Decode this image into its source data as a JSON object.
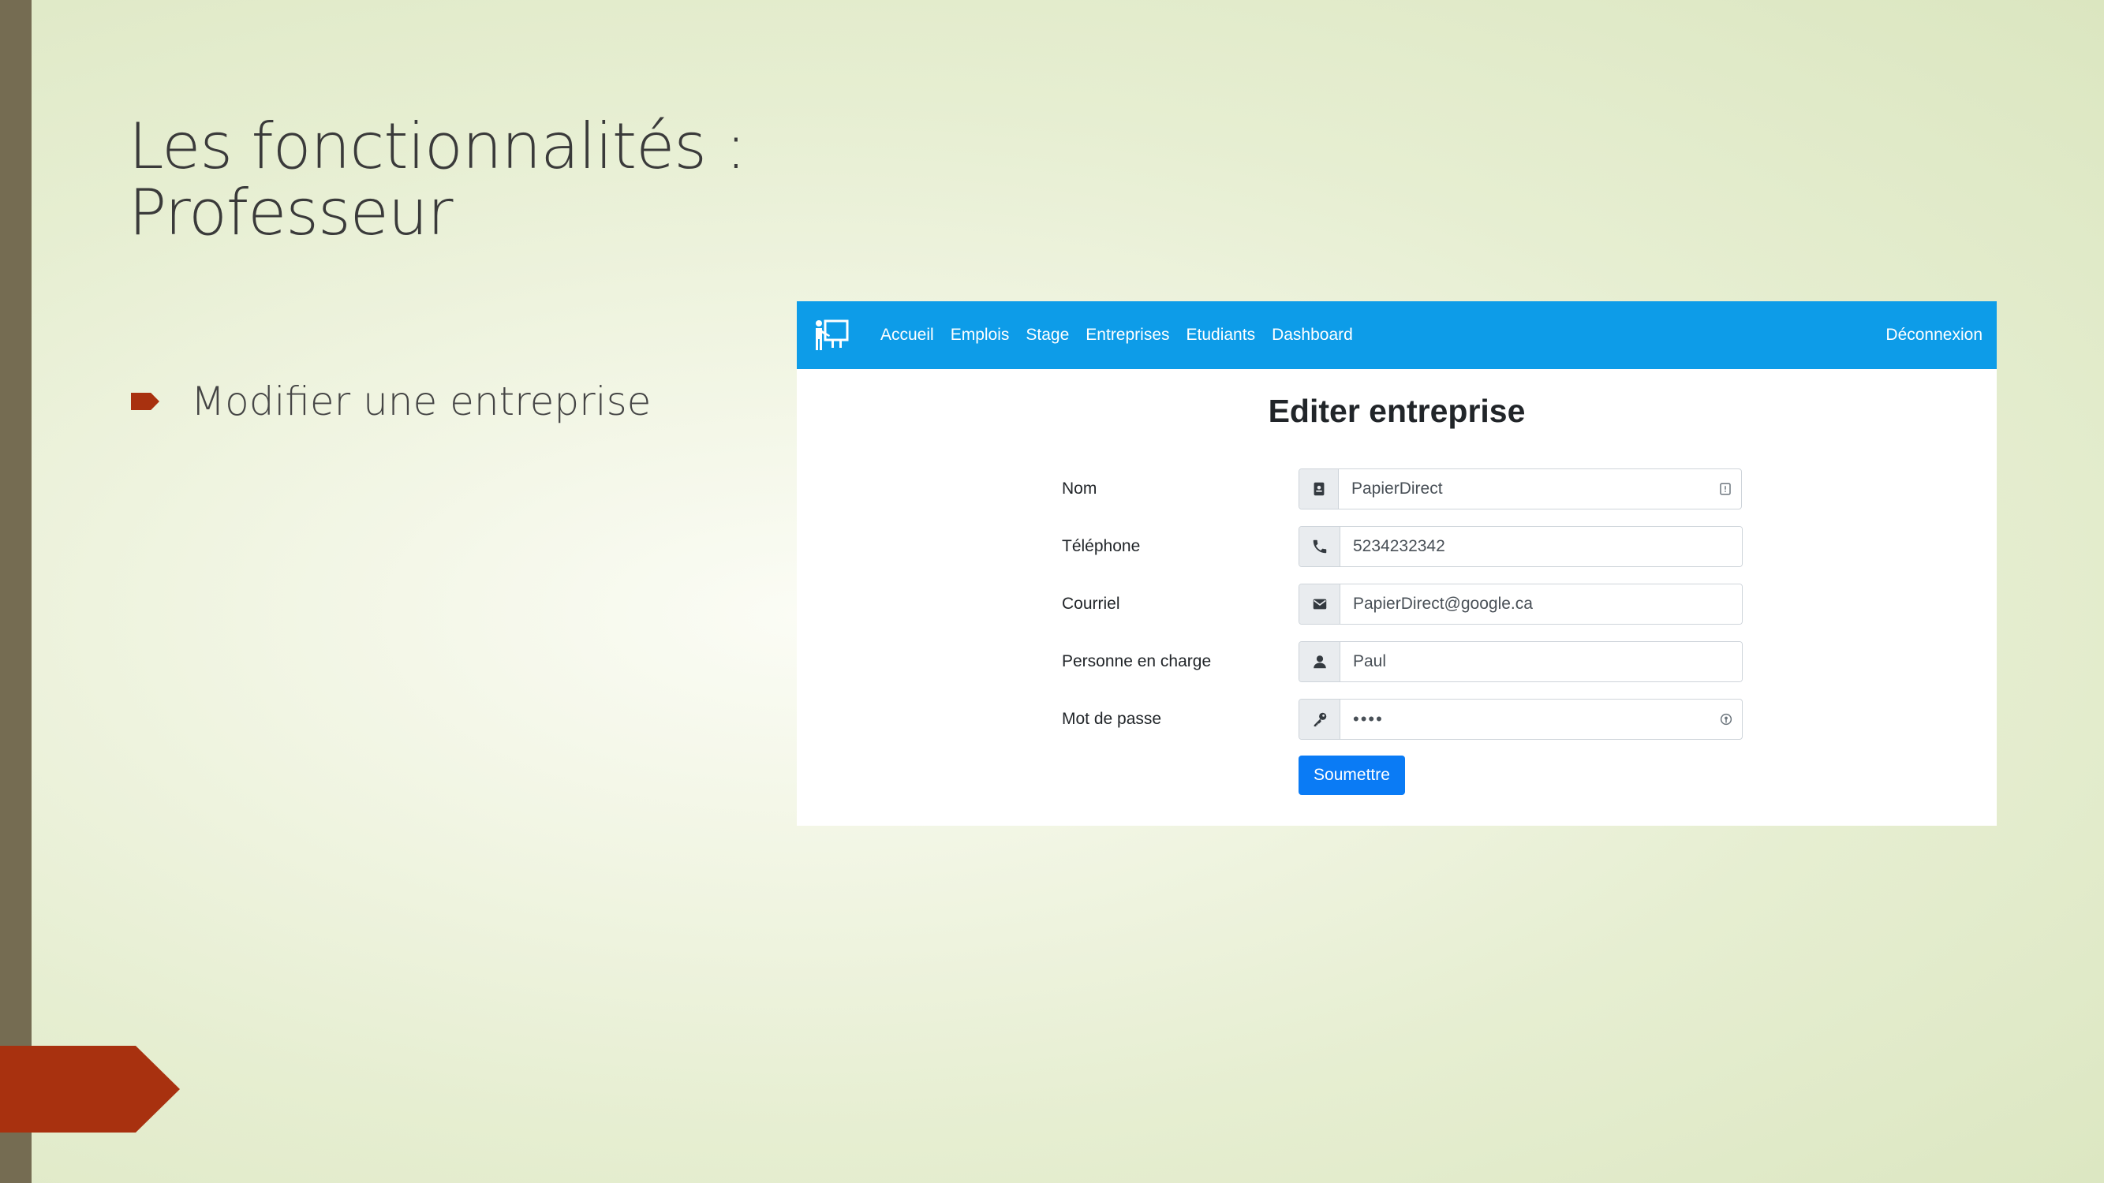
{
  "slide": {
    "title_line1": "Les fonctionnalités :",
    "title_line2": "Professeur",
    "bullet": "Modifier une entreprise"
  },
  "navbar": {
    "links": [
      "Accueil",
      "Emplois",
      "Stage",
      "Entreprises",
      "Etudiants",
      "Dashboard"
    ],
    "logout": "Déconnexion",
    "brand_icon": "teacher-board-icon",
    "color": "#0d9ce8"
  },
  "form": {
    "title": "Editer entreprise",
    "fields": [
      {
        "label": "Nom",
        "value": "PapierDirect",
        "icon": "id-card-icon"
      },
      {
        "label": "Téléphone",
        "value": "5234232342",
        "icon": "phone-icon"
      },
      {
        "label": "Courriel",
        "value": "PapierDirect@google.ca",
        "icon": "envelope-icon"
      },
      {
        "label": "Personne en charge",
        "value": "Paul",
        "icon": "user-icon"
      },
      {
        "label": "Mot de passe",
        "value": "••••",
        "icon": "key-icon"
      }
    ],
    "submit": "Soumettre",
    "submit_color": "#0a7bf5"
  }
}
